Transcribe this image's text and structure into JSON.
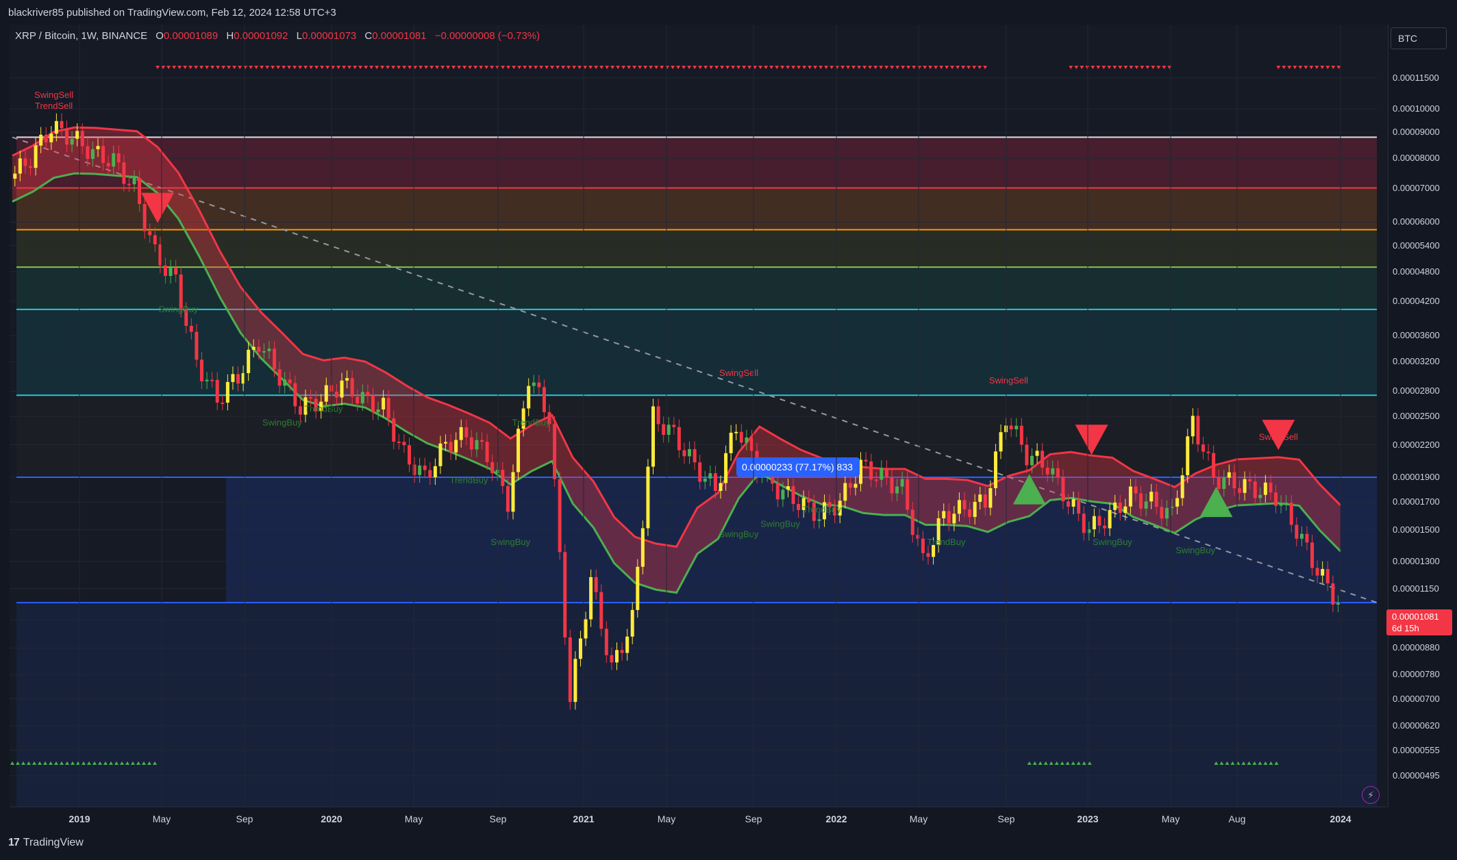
{
  "header": {
    "published": "blackriver85 published on TradingView.com, Feb 12, 2024 12:58 UTC+3"
  },
  "legend": {
    "symbol": "XRP / Bitcoin, 1W, BINANCE",
    "o_label": "O",
    "o_value": "0.00001089",
    "h_label": "H",
    "h_value": "0.00001092",
    "l_label": "L",
    "l_value": "0.00001073",
    "c_label": "C",
    "c_value": "0.00001081",
    "change": "−0.00000008 (−0.73%)"
  },
  "currency_button": "BTC",
  "price_tag": {
    "value": "0.00001081",
    "countdown": "6d 15h",
    "color": "#f23645"
  },
  "footer": {
    "brand": "TradingView",
    "logo_text": "17"
  },
  "chart_data": {
    "type": "candlestick",
    "title": "XRP / Bitcoin, 1W, BINANCE",
    "y_scale": "log",
    "y_ticks": [
      "0.00011500",
      "0.00010000",
      "0.00009000",
      "0.00008000",
      "0.00007000",
      "0.00006000",
      "0.00005400",
      "0.00004800",
      "0.00004200",
      "0.00003600",
      "0.00003200",
      "0.00002800",
      "0.00002500",
      "0.00002200",
      "0.00001900",
      "0.00001700",
      "0.00001500",
      "0.00001300",
      "0.00001150",
      "0.00001000",
      "0.00000880",
      "0.00000780",
      "0.00000700",
      "0.00000620",
      "0.00000555",
      "0.00000495"
    ],
    "x_ticks": [
      {
        "label": "2019",
        "year": true
      },
      {
        "label": "May",
        "year": false
      },
      {
        "label": "Sep",
        "year": false
      },
      {
        "label": "2020",
        "year": true
      },
      {
        "label": "May",
        "year": false
      },
      {
        "label": "Sep",
        "year": false
      },
      {
        "label": "2021",
        "year": true
      },
      {
        "label": "May",
        "year": false
      },
      {
        "label": "Sep",
        "year": false
      },
      {
        "label": "2022",
        "year": true
      },
      {
        "label": "May",
        "year": false
      },
      {
        "label": "Sep",
        "year": false
      },
      {
        "label": "2023",
        "year": true
      },
      {
        "label": "May",
        "year": false
      },
      {
        "label": "Aug",
        "year": false
      },
      {
        "label": "2024",
        "year": true
      }
    ],
    "price_path": [
      [
        "2018-10",
        7.3e-05
      ],
      [
        "2018-11",
        8e-05
      ],
      [
        "2018-12",
        9.2e-05
      ],
      [
        "2019-01",
        8.8e-05
      ],
      [
        "2019-02",
        8.2e-05
      ],
      [
        "2019-03",
        7.9e-05
      ],
      [
        "2019-04",
        7e-05
      ],
      [
        "2019-05",
        5.2e-05
      ],
      [
        "2019-06",
        4.6e-05
      ],
      [
        "2019-07",
        3.2e-05
      ],
      [
        "2019-08",
        2.7e-05
      ],
      [
        "2019-09",
        3e-05
      ],
      [
        "2019-10",
        3.5e-05
      ],
      [
        "2019-11",
        3e-05
      ],
      [
        "2019-12",
        2.6e-05
      ],
      [
        "2020-01",
        2.7e-05
      ],
      [
        "2020-02",
        2.9e-05
      ],
      [
        "2020-03",
        2.7e-05
      ],
      [
        "2020-04",
        2.6e-05
      ],
      [
        "2020-05",
        2.1e-05
      ],
      [
        "2020-06",
        1.9e-05
      ],
      [
        "2020-07",
        2.2e-05
      ],
      [
        "2020-08",
        2.3e-05
      ],
      [
        "2020-09",
        2.1e-05
      ],
      [
        "2020-10",
        1.7e-05
      ],
      [
        "2020-11",
        3e-05
      ],
      [
        "2020-12",
        2.5e-05
      ],
      [
        "2021-01",
        7e-06
      ],
      [
        "2021-02",
        1.2e-05
      ],
      [
        "2021-03",
        8e-06
      ],
      [
        "2021-04",
        1e-05
      ],
      [
        "2021-05",
        2.5e-05
      ],
      [
        "2021-06",
        2.3e-05
      ],
      [
        "2021-07",
        2e-05
      ],
      [
        "2021-08",
        1.8e-05
      ],
      [
        "2021-09",
        2.4e-05
      ],
      [
        "2021-10",
        2e-05
      ],
      [
        "2021-11",
        1.8e-05
      ],
      [
        "2021-12",
        1.7e-05
      ],
      [
        "2022-01",
        1.6e-05
      ],
      [
        "2022-02",
        1.7e-05
      ],
      [
        "2022-03",
        2e-05
      ],
      [
        "2022-04",
        1.9e-05
      ],
      [
        "2022-05",
        1.8e-05
      ],
      [
        "2022-06",
        1.3e-05
      ],
      [
        "2022-07",
        1.6e-05
      ],
      [
        "2022-08",
        1.65e-05
      ],
      [
        "2022-09",
        1.7e-05
      ],
      [
        "2022-10",
        2.5e-05
      ],
      [
        "2022-11",
        2.1e-05
      ],
      [
        "2022-12",
        2e-05
      ],
      [
        "2023-01",
        1.7e-05
      ],
      [
        "2023-02",
        1.5e-05
      ],
      [
        "2023-03",
        1.6e-05
      ],
      [
        "2023-04",
        1.75e-05
      ],
      [
        "2023-05",
        1.7e-05
      ],
      [
        "2023-06",
        1.6e-05
      ],
      [
        "2023-07",
        2.45e-05
      ],
      [
        "2023-08",
        1.9e-05
      ],
      [
        "2023-09",
        1.85e-05
      ],
      [
        "2023-10",
        1.8e-05
      ],
      [
        "2023-11",
        1.75e-05
      ],
      [
        "2023-12",
        1.5e-05
      ],
      [
        "2024-01",
        1.25e-05
      ],
      [
        "2024-02",
        1.08e-05
      ]
    ],
    "horizontal_levels": [
      {
        "price": 8.8e-05,
        "color": "#e0e0e0"
      },
      {
        "price": 7e-05,
        "color": "#f23645"
      },
      {
        "price": 5.8e-05,
        "color": "#ff9800"
      },
      {
        "price": 4.9e-05,
        "color": "#8bc34a"
      },
      {
        "price": 4.05e-05,
        "color": "#26c6da"
      },
      {
        "price": 2.75e-05,
        "color": "#26c6da"
      },
      {
        "price": 1.9e-05,
        "color": "#2962ff"
      },
      {
        "price": 1.08e-05,
        "color": "#2962ff"
      }
    ],
    "signal_labels": [
      {
        "text": "SwingSell",
        "color": "#f23645",
        "date": "2018-12",
        "price": 0.000105
      },
      {
        "text": "TrendSell",
        "color": "#f23645",
        "date": "2018-12",
        "price": 0.0001
      },
      {
        "text": "SwingBuy",
        "color": "#2e7d32",
        "date": "2019-06",
        "price": 4e-05
      },
      {
        "text": "SwingBuy",
        "color": "#2e7d32",
        "date": "2019-11",
        "price": 2.4e-05
      },
      {
        "text": "TrendBuy",
        "color": "#2e7d32",
        "date": "2020-01",
        "price": 2.55e-05
      },
      {
        "text": "TrendBuy",
        "color": "#2e7d32",
        "date": "2020-08",
        "price": 1.85e-05
      },
      {
        "text": "SwingBuy",
        "color": "#2e7d32",
        "date": "2020-10",
        "price": 1.4e-05
      },
      {
        "text": "TrendBuy",
        "color": "#2e7d32",
        "date": "2020-11",
        "price": 2.4e-05
      },
      {
        "text": "SwingSell",
        "color": "#f23645",
        "date": "2021-09",
        "price": 3e-05
      },
      {
        "text": "SwingBuy",
        "color": "#2e7d32",
        "date": "2021-09",
        "price": 1.45e-05
      },
      {
        "text": "SwingBuy",
        "color": "#2e7d32",
        "date": "2021-11",
        "price": 1.52e-05
      },
      {
        "text": "TrendBuy",
        "color": "#2e7d32",
        "date": "2022-01",
        "price": 1.62e-05
      },
      {
        "text": "TrendBuy",
        "color": "#2e7d32",
        "date": "2022-07",
        "price": 1.4e-05
      },
      {
        "text": "SwingSell",
        "color": "#f23645",
        "date": "2022-10",
        "price": 2.9e-05
      },
      {
        "text": "SwingBuy",
        "color": "#2e7d32",
        "date": "2023-03",
        "price": 1.4e-05
      },
      {
        "text": "SwingBuy",
        "color": "#2e7d32",
        "date": "2023-07",
        "price": 1.35e-05
      },
      {
        "text": "SwingSell",
        "color": "#f23645",
        "date": "2023-11",
        "price": 2.25e-05
      }
    ],
    "big_markers": [
      {
        "type": "down",
        "color": "#f23645",
        "date": "2019-05",
        "price": 6.4e-05
      },
      {
        "type": "up",
        "color": "#4caf50",
        "date": "2022-11",
        "price": 1.8e-05
      },
      {
        "type": "down",
        "color": "#f23645",
        "date": "2023-02",
        "price": 2.25e-05
      },
      {
        "type": "up",
        "color": "#4caf50",
        "date": "2023-08",
        "price": 1.7e-05
      },
      {
        "type": "down",
        "color": "#f23645",
        "date": "2023-11",
        "price": 2.3e-05
      }
    ],
    "measurement_label": "0.00000233 (77.17%) 833",
    "down_triangle_rows": [
      {
        "from": "2019-05",
        "to": "2022-09"
      },
      {
        "from": "2023-01",
        "to": "2023-06"
      },
      {
        "from": "2023-11",
        "to": "2024-02"
      }
    ],
    "up_triangle_rows": [
      {
        "from": "2018-10",
        "to": "2019-05"
      },
      {
        "from": "2022-11",
        "to": "2023-02"
      },
      {
        "from": "2023-08",
        "to": "2023-11"
      }
    ]
  }
}
